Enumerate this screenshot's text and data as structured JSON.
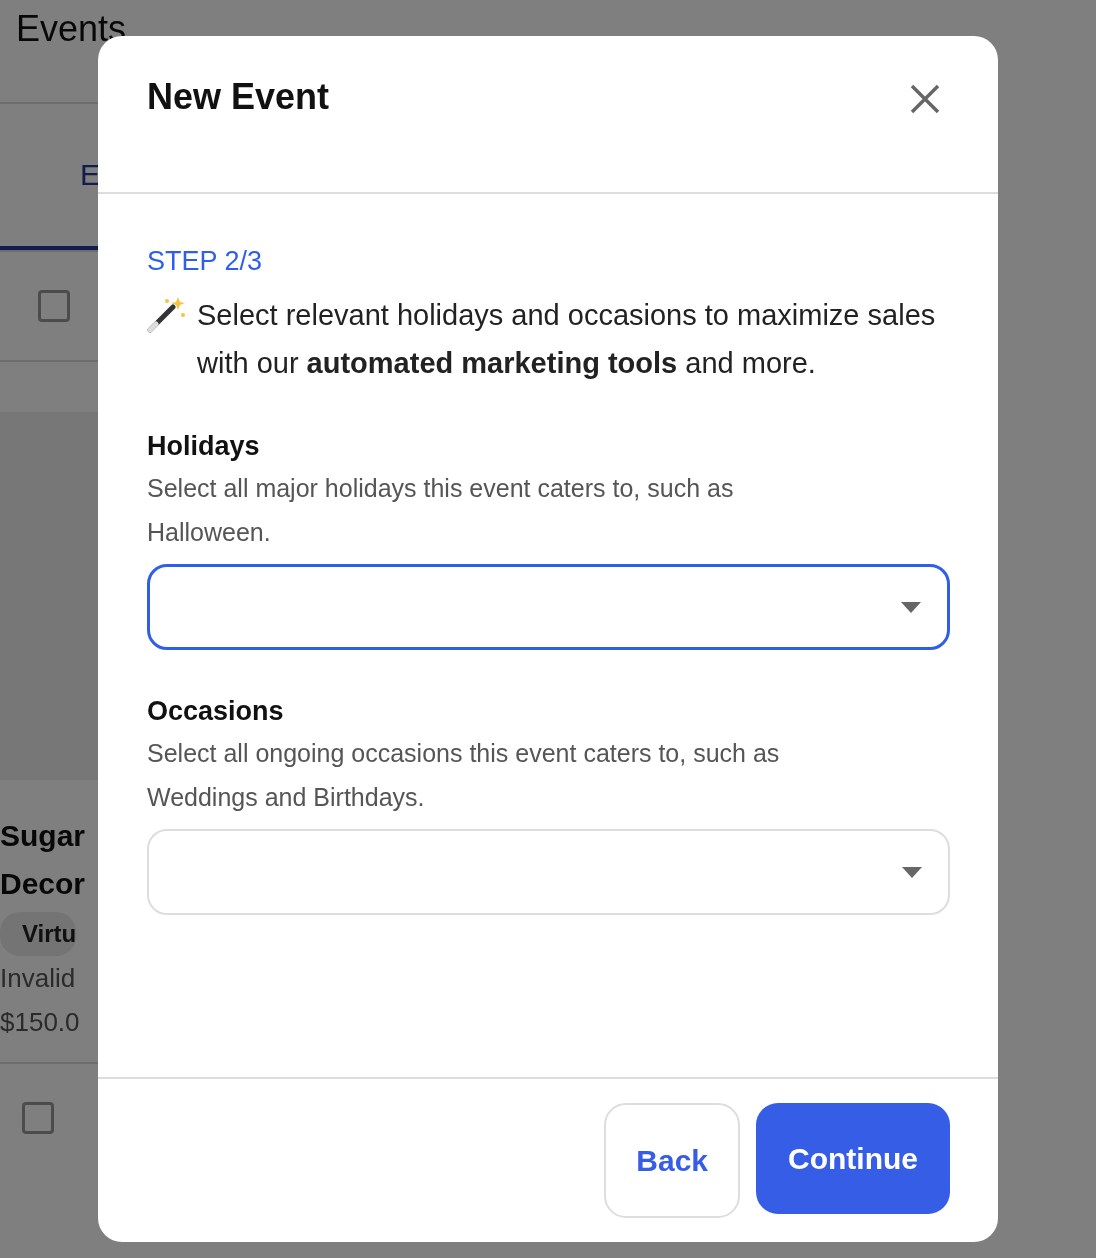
{
  "background": {
    "page_title": "Events",
    "tab": {
      "label": "E",
      "selected": true
    },
    "checkboxes": [
      {
        "checked": false
      },
      {
        "checked": false
      }
    ],
    "card": {
      "title_lines": [
        "Sugar",
        "Decor"
      ],
      "badge": "Virtu",
      "note": "Invalid",
      "price": "$150.0"
    }
  },
  "modal": {
    "title": "New Event",
    "step": "STEP 2/3",
    "intro": "Select relevant holidays and occasions to maximize sales with our **automated marketing tools** and more.",
    "fields": [
      {
        "label": "Holidays",
        "help": "Select all major holidays this event caters to, such as Halloween.",
        "focused": true
      },
      {
        "label": "Occasions",
        "help": "Select all ongoing occasions this event caters to, such as Weddings and Birthdays.",
        "focused": false
      }
    ],
    "buttons": [
      {
        "label": "Back",
        "kind": "secondary"
      },
      {
        "label": "Continue",
        "kind": "primary"
      }
    ]
  }
}
